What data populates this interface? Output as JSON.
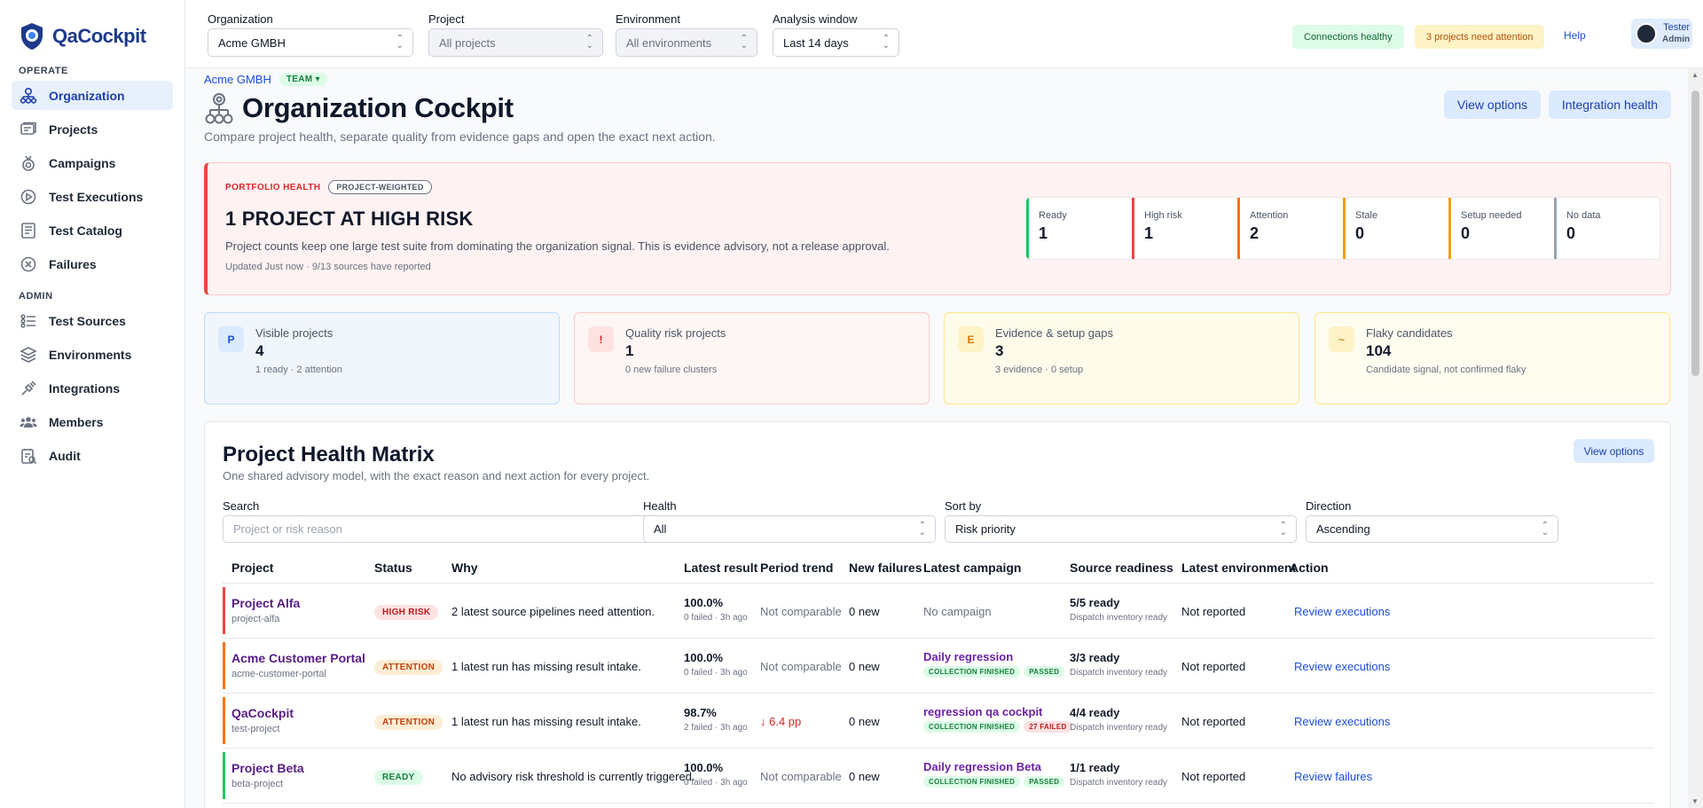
{
  "app": {
    "name": "QaCockpit"
  },
  "sidebar": {
    "sections": [
      {
        "title": "OPERATE",
        "items": [
          {
            "label": "Organization",
            "icon": "organization-icon",
            "active": true
          },
          {
            "label": "Projects",
            "icon": "projects-icon"
          },
          {
            "label": "Campaigns",
            "icon": "campaigns-icon"
          },
          {
            "label": "Test Executions",
            "icon": "test-executions-icon"
          },
          {
            "label": "Test Catalog",
            "icon": "test-catalog-icon"
          },
          {
            "label": "Failures",
            "icon": "failures-icon"
          }
        ]
      },
      {
        "title": "ADMIN",
        "items": [
          {
            "label": "Test Sources",
            "icon": "test-sources-icon"
          },
          {
            "label": "Environments",
            "icon": "environments-icon"
          },
          {
            "label": "Integrations",
            "icon": "integrations-icon"
          },
          {
            "label": "Members",
            "icon": "members-icon"
          },
          {
            "label": "Audit",
            "icon": "audit-icon"
          }
        ]
      }
    ]
  },
  "topbar": {
    "filters": {
      "organization": {
        "label": "Organization",
        "value": "Acme GMBH"
      },
      "project": {
        "label": "Project",
        "value": "All projects"
      },
      "environment": {
        "label": "Environment",
        "value": "All environments"
      },
      "window": {
        "label": "Analysis window",
        "value": "Last 14 days"
      }
    },
    "connections": "Connections healthy",
    "attention": "3 projects need attention",
    "help": "Help",
    "user": {
      "name": "Tester",
      "role": "Admin"
    }
  },
  "header": {
    "org": "Acme GMBH",
    "team_badge": "TEAM",
    "title": "Organization Cockpit",
    "subtitle": "Compare project health, separate quality from evidence gaps and open the exact next action.",
    "view_options": "View options",
    "integration_health": "Integration health"
  },
  "portfolio": {
    "kicker": "PORTFOLIO HEALTH",
    "badge": "PROJECT-WEIGHTED",
    "title": "1 PROJECT AT HIGH RISK",
    "description": "Project counts keep one large test suite from dominating the organization signal. This is evidence advisory, not a release approval.",
    "updated": "Updated Just now · 9/13 sources have reported",
    "stats": [
      {
        "label": "Ready",
        "value": "1",
        "color": "#22c55e"
      },
      {
        "label": "High risk",
        "value": "1",
        "color": "#ef4444"
      },
      {
        "label": "Attention",
        "value": "2",
        "color": "#f97316"
      },
      {
        "label": "Stale",
        "value": "0",
        "color": "#f59e0b"
      },
      {
        "label": "Setup needed",
        "value": "0",
        "color": "#f59e0b"
      },
      {
        "label": "No data",
        "value": "0",
        "color": "#9ca3af"
      }
    ]
  },
  "kpis": [
    {
      "icon": "P",
      "label": "Visible projects",
      "value": "4",
      "sub": "1 ready · 2 attention"
    },
    {
      "icon": "!",
      "label": "Quality risk projects",
      "value": "1",
      "sub": "0 new failure clusters"
    },
    {
      "icon": "E",
      "label": "Evidence & setup gaps",
      "value": "3",
      "sub": "3 evidence · 0 setup"
    },
    {
      "icon": "~",
      "label": "Flaky candidates",
      "value": "104",
      "sub": "Candidate signal, not confirmed flaky"
    }
  ],
  "matrix": {
    "title": "Project Health Matrix",
    "subtitle": "One shared advisory model, with the exact reason and next action for every project.",
    "view_options": "View options",
    "filters": {
      "search": {
        "label": "Search",
        "placeholder": "Project or risk reason"
      },
      "health": {
        "label": "Health",
        "value": "All"
      },
      "sort": {
        "label": "Sort by",
        "value": "Risk priority"
      },
      "direction": {
        "label": "Direction",
        "value": "Ascending"
      }
    },
    "columns": [
      "Project",
      "Status",
      "Why",
      "Latest result",
      "Period trend",
      "New failures",
      "Latest campaign",
      "Source readiness",
      "Latest environment",
      "Action"
    ],
    "rows": [
      {
        "accent": "#ef4444",
        "name": "Project Alfa",
        "slug": "project-alfa",
        "status": "HIGH RISK",
        "status_kind": "high",
        "why": "2 latest source pipelines need attention.",
        "result": "100.0%",
        "result_sub": "0 failed · 3h ago",
        "trend": "Not comparable",
        "trend_kind": "muted",
        "new_failures": "0 new",
        "campaign": "",
        "campaign_empty": "No campaign",
        "tags": [],
        "readiness": "5/5 ready",
        "readiness_sub": "Dispatch inventory ready",
        "environment": "Not reported",
        "action": "Review executions"
      },
      {
        "accent": "#f97316",
        "name": "Acme Customer Portal",
        "slug": "acme-customer-portal",
        "status": "ATTENTION",
        "status_kind": "att",
        "why": "1 latest run has missing result intake.",
        "result": "100.0%",
        "result_sub": "0 failed · 3h ago",
        "trend": "Not comparable",
        "trend_kind": "muted",
        "new_failures": "0 new",
        "campaign": "Daily regression",
        "campaign_empty": "",
        "tags": [
          {
            "text": "COLLECTION FINISHED",
            "kind": "green"
          },
          {
            "text": "PASSED",
            "kind": "green"
          }
        ],
        "readiness": "3/3 ready",
        "readiness_sub": "Dispatch inventory ready",
        "environment": "Not reported",
        "action": "Review executions"
      },
      {
        "accent": "#f97316",
        "name": "QaCockpit",
        "slug": "test-project",
        "status": "ATTENTION",
        "status_kind": "att",
        "why": "1 latest run has missing result intake.",
        "result": "98.7%",
        "result_sub": "2 failed · 3h ago",
        "trend": "↓ 6.4 pp",
        "trend_kind": "down",
        "new_failures": "0 new",
        "campaign": "regression qa cockpit",
        "campaign_empty": "",
        "tags": [
          {
            "text": "COLLECTION FINISHED",
            "kind": "green"
          },
          {
            "text": "27 FAILED",
            "kind": "red"
          }
        ],
        "readiness": "4/4 ready",
        "readiness_sub": "Dispatch inventory ready",
        "environment": "Not reported",
        "action": "Review executions"
      },
      {
        "accent": "#22c55e",
        "name": "Project Beta",
        "slug": "beta-project",
        "status": "READY",
        "status_kind": "ready",
        "why": "No advisory risk threshold is currently triggered.",
        "result": "100.0%",
        "result_sub": "0 failed · 3h ago",
        "trend": "Not comparable",
        "trend_kind": "muted",
        "new_failures": "0 new",
        "campaign": "Daily regression Beta",
        "campaign_empty": "",
        "tags": [
          {
            "text": "COLLECTION FINISHED",
            "kind": "green"
          },
          {
            "text": "PASSED",
            "kind": "green"
          }
        ],
        "readiness": "1/1 ready",
        "readiness_sub": "Dispatch inventory ready",
        "environment": "Not reported",
        "action": "Review failures"
      }
    ]
  }
}
